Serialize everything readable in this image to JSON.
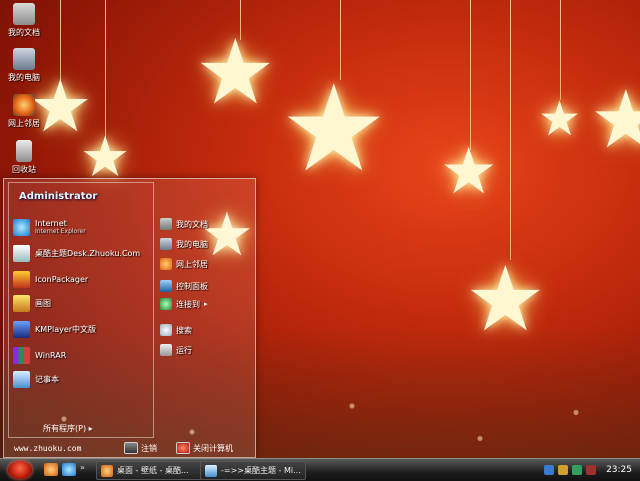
{
  "desktop": {
    "icons": [
      {
        "label": "我的文档",
        "icon": "my-documents-icon"
      },
      {
        "label": "我的电脑",
        "icon": "my-computer-icon"
      },
      {
        "label": "网上邻居",
        "icon": "network-icon"
      },
      {
        "label": "回收站",
        "icon": "recycle-bin-icon"
      }
    ]
  },
  "start_menu": {
    "user": "Administrator",
    "pinned": [
      {
        "title": "Internet",
        "subtitle": "Internet Explorer",
        "icon": "internet-explorer-icon"
      },
      {
        "title": "桌酷主题Desk.Zhuoku.Com",
        "icon": "theme-app-icon"
      },
      {
        "title": "IconPackager",
        "icon": "iconpackager-icon"
      },
      {
        "title": "画图",
        "icon": "paint-icon"
      },
      {
        "title": "KMPlayer中文版",
        "icon": "kmplayer-icon"
      },
      {
        "title": "WinRAR",
        "icon": "winrar-icon"
      },
      {
        "title": "记事本",
        "icon": "notepad-icon"
      }
    ],
    "all_programs": "所有程序(P)",
    "right_items": [
      {
        "label": "我的文档",
        "icon": "folder-icon"
      },
      {
        "label": "我的电脑",
        "icon": "computer-icon"
      },
      {
        "label": "网上邻居",
        "icon": "network-icon"
      },
      {
        "label": "控制面板",
        "icon": "control-panel-icon"
      },
      {
        "label": "连接到",
        "icon": "connect-icon"
      },
      {
        "label": "搜索",
        "icon": "search-icon"
      },
      {
        "label": "运行",
        "icon": "run-icon"
      }
    ],
    "site": "www.zhuoku.com",
    "logoff": "注销",
    "shutdown": "关闭计算机"
  },
  "taskbar": {
    "tasks": [
      {
        "label": "桌面 - 壁纸 - 桌酷...",
        "icon": "browser-icon"
      },
      {
        "label": "-=>>桌酷主题 - Mi...",
        "icon": "editor-icon"
      }
    ],
    "clock": "23:25"
  },
  "colors": {
    "wallpaper": "#c22a0c",
    "taskbar": "#1e1e1e",
    "accent": "#ff6b4a"
  }
}
